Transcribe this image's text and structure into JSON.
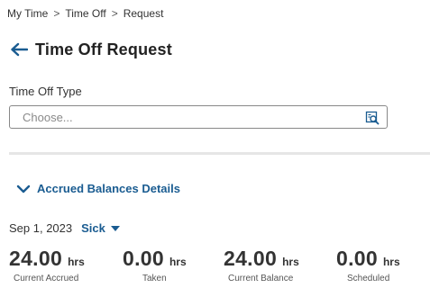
{
  "breadcrumb": {
    "items": [
      "My Time",
      "Time Off",
      "Request"
    ],
    "separator": ">"
  },
  "header": {
    "title": "Time Off Request"
  },
  "form": {
    "time_off_type_label": "Time Off Type",
    "time_off_type_placeholder": "Choose...",
    "time_off_type_value": ""
  },
  "accrued": {
    "label": "Accrued Balances Details",
    "expanded": true
  },
  "balance_date": "Sep 1, 2023",
  "balance_type": "Sick",
  "balances": [
    {
      "value": "24.00",
      "unit": "hrs",
      "caption": "Current Accrued"
    },
    {
      "value": "0.00",
      "unit": "hrs",
      "caption": "Taken"
    },
    {
      "value": "24.00",
      "unit": "hrs",
      "caption": "Current Balance"
    },
    {
      "value": "0.00",
      "unit": "hrs",
      "caption": "Scheduled"
    }
  ],
  "colors": {
    "accent": "#1a5c91",
    "text": "#333333",
    "divider": "#e6e6e6"
  }
}
